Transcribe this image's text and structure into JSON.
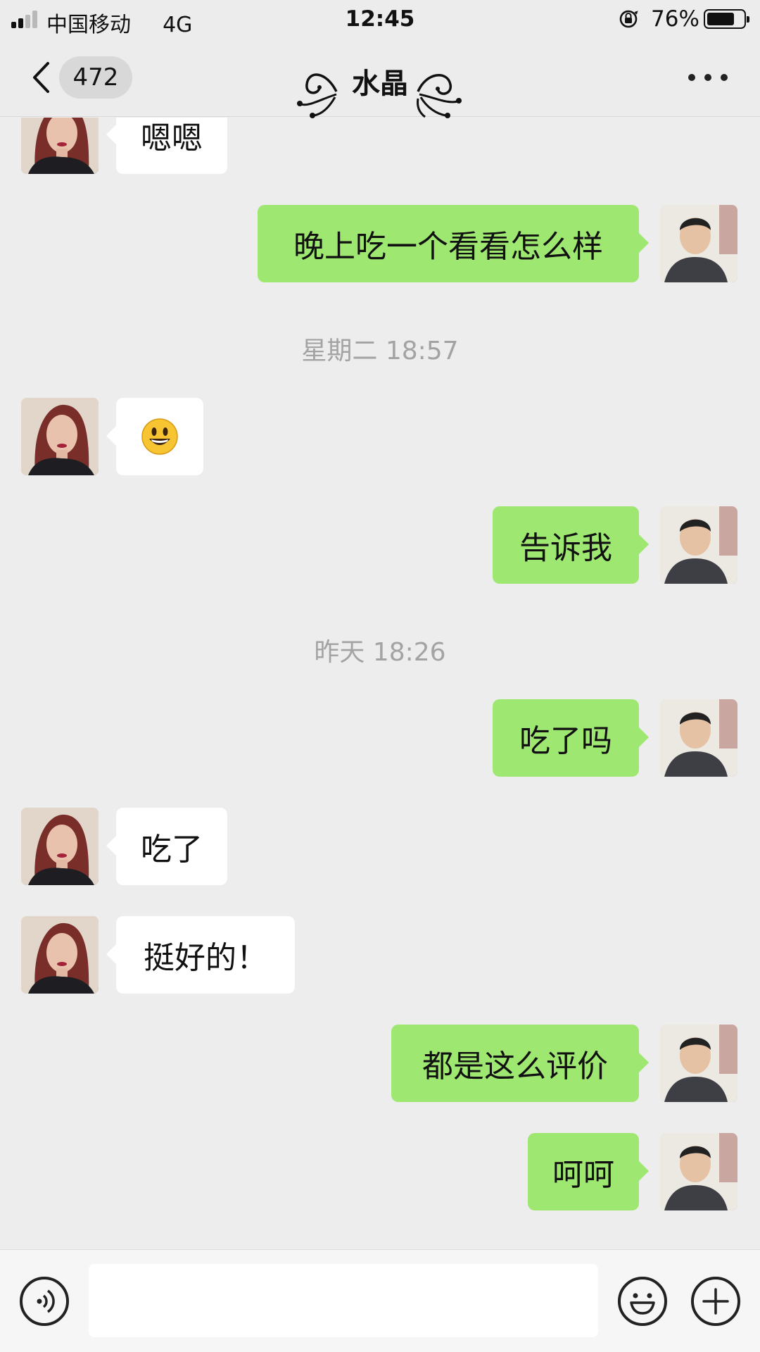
{
  "status_bar": {
    "carrier": "中国移动",
    "network": "4G",
    "time": "12:45",
    "battery_percent": "76%",
    "battery_level": 0.76
  },
  "nav": {
    "unread_count": "472",
    "title": "水晶"
  },
  "chat": {
    "timestamps": [
      "星期二 18:57",
      "昨天 18:26"
    ],
    "messages": [
      {
        "side": "left",
        "text": "嗯嗯"
      },
      {
        "side": "right",
        "text": "晚上吃一个看看怎么样"
      },
      {
        "side": "left",
        "text": "😃"
      },
      {
        "side": "right",
        "text": "告诉我"
      },
      {
        "side": "right",
        "text": "吃了吗"
      },
      {
        "side": "left",
        "text": "吃了"
      },
      {
        "side": "left",
        "text": "挺好的！"
      },
      {
        "side": "right",
        "text": "都是这么评价"
      },
      {
        "side": "right",
        "text": "呵呵"
      }
    ]
  },
  "input_bar": {
    "message_value": "",
    "icons": [
      "voice-icon",
      "emoji-icon",
      "plus-icon"
    ]
  },
  "colors": {
    "background": "#ededed",
    "outgoing_bubble": "#9ee871",
    "incoming_bubble": "#ffffff",
    "timestamp_text": "#a3a3a3"
  }
}
